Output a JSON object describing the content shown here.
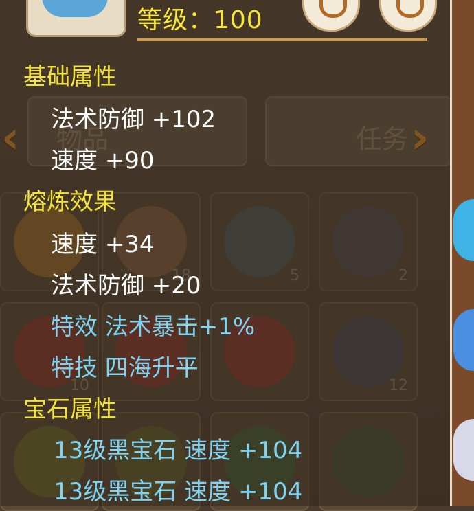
{
  "header": {
    "level_text": "等级：100"
  },
  "background": {
    "tab_left_label": "物品",
    "tab_right_label": "任务",
    "slot_counts": [
      "18",
      "5",
      "2",
      "10",
      "12"
    ]
  },
  "sections": {
    "base": {
      "title": "基础属性",
      "lines": [
        "法术防御  +102",
        "速度  +90"
      ]
    },
    "refine": {
      "title": "熔炼效果",
      "lines": [
        "速度  +34",
        "法术防御  +20"
      ],
      "special": [
        "特效  法术暴击+1%",
        "特技  四海升平"
      ]
    },
    "gem": {
      "title": "宝石属性",
      "lines": [
        "13级黑宝石  速度  +104",
        "13级黑宝石  速度  +104"
      ]
    }
  },
  "colors": {
    "section_title": "#f2e33b",
    "attribute": "#ffffff",
    "special": "#7fd3f0",
    "level": "#f6e63a"
  }
}
